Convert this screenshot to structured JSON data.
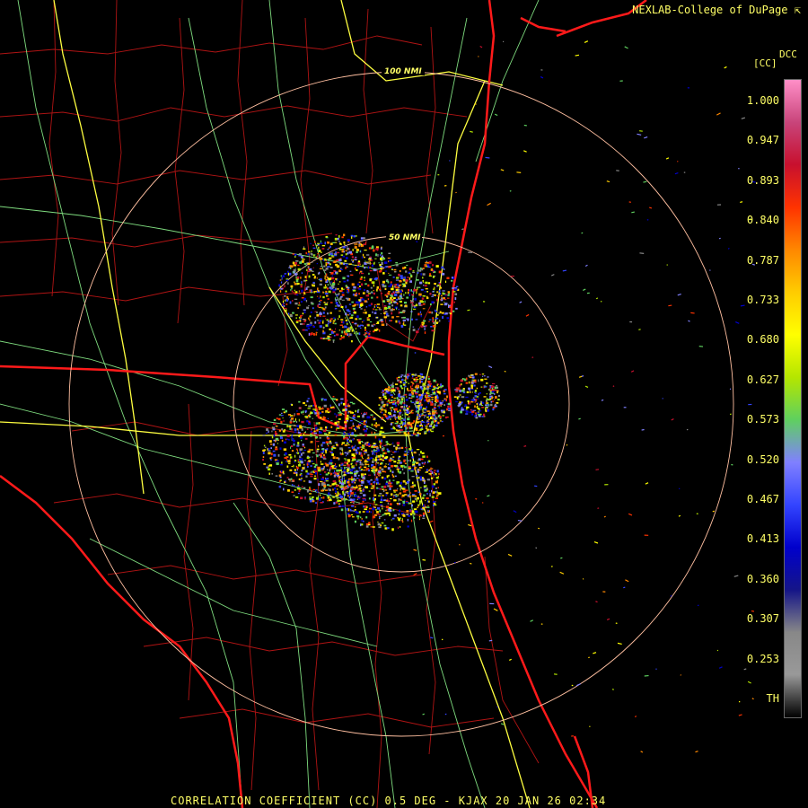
{
  "header": {
    "credit": "NEXLAB-College of DuPage",
    "credit_icon": "arrow-nw-icon"
  },
  "footer": {
    "product_line": "CORRELATION COEFFICIENT (CC) 0.5 DEG - KJAX 20 JAN 26 02:34"
  },
  "legend": {
    "title": "DCC",
    "unit": "[CC]",
    "ticks": [
      "1.000",
      "0.947",
      "0.893",
      "0.840",
      "0.787",
      "0.733",
      "0.680",
      "0.627",
      "0.573",
      "0.520",
      "0.467",
      "0.413",
      "0.360",
      "0.307",
      "0.253",
      "TH"
    ],
    "colors": [
      "#ff8fc8",
      "#c8447a",
      "#c8102e",
      "#ff3300",
      "#ff8800",
      "#ffcc00",
      "#ffff00",
      "#b4e600",
      "#5fd05f",
      "#8080ff",
      "#3344ff",
      "#0000cc",
      "#151588",
      "#888888",
      "#999999",
      "#000000"
    ]
  },
  "rings": [
    {
      "label": "100 NMI"
    },
    {
      "label": "50 NMI"
    }
  ],
  "colors": {
    "state_lines": "#ff2020",
    "county_lines": "#c81414",
    "highways": "#ffff40",
    "roads": "#90e890",
    "rings": "#ffbfa0",
    "text": "#ffff66"
  }
}
